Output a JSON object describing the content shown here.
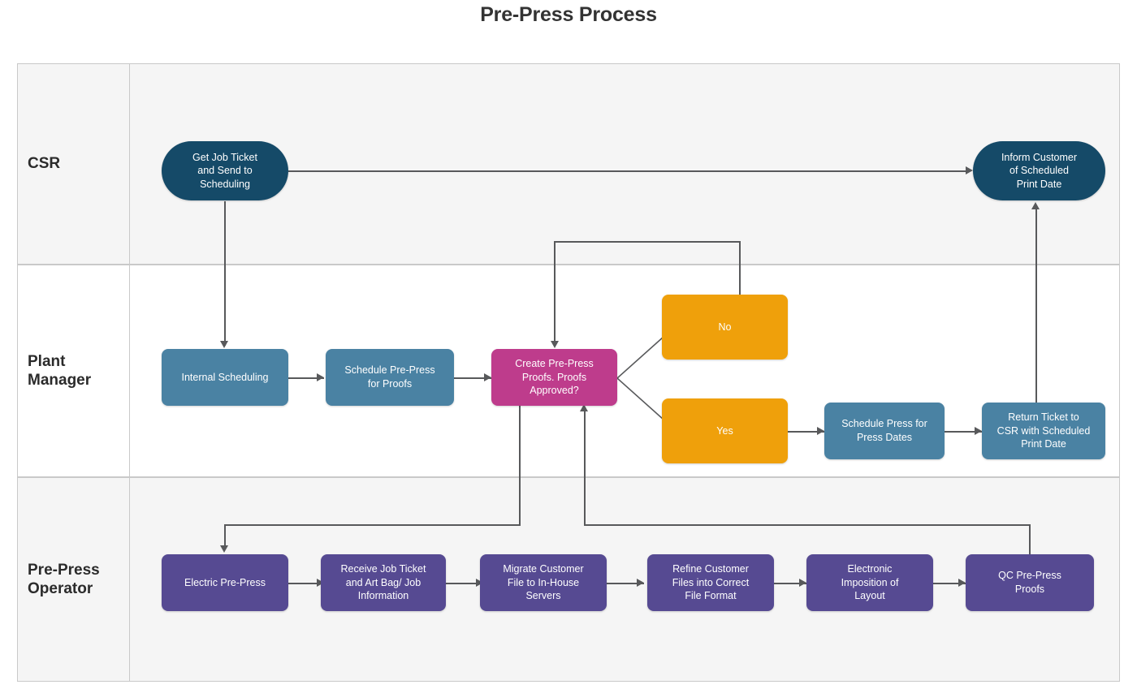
{
  "title": "Pre-Press Process",
  "colors": {
    "navy": "#154A68",
    "steel_blue": "#4A82A3",
    "magenta": "#BE3C8C",
    "orange": "#EFA00B",
    "purple": "#564A92",
    "connector": "#58595b",
    "lane_border": "#c9c9c9",
    "lane_shaded": "#f5f5f5",
    "lane_plain": "#ffffff"
  },
  "lanes": [
    {
      "id": "csr",
      "label": "CSR"
    },
    {
      "id": "plant-manager",
      "label": "Plant\nManager"
    },
    {
      "id": "pre-press-operator",
      "label": "Pre-Press\nOperator"
    }
  ],
  "nodes": {
    "get_job_ticket": {
      "label": "Get Job Ticket\nand Send to\nScheduling",
      "lane": "csr",
      "shape": "pill",
      "color": "navy"
    },
    "inform_customer": {
      "label": "Inform Customer\nof Scheduled\nPrint Date",
      "lane": "csr",
      "shape": "pill",
      "color": "navy"
    },
    "internal_scheduling": {
      "label": "Internal Scheduling",
      "lane": "plant-manager",
      "shape": "rounded-rect",
      "color": "steel_blue"
    },
    "schedule_prepress": {
      "label": "Schedule Pre-Press\nfor Proofs",
      "lane": "plant-manager",
      "shape": "rounded-rect",
      "color": "steel_blue"
    },
    "create_prepress_proofs": {
      "label": "Create Pre-Press\nProofs. Proofs\nApproved?",
      "lane": "plant-manager",
      "shape": "rounded-rect",
      "color": "magenta"
    },
    "decision_no": {
      "label": "No",
      "lane": "plant-manager",
      "shape": "rounded-rect",
      "color": "orange"
    },
    "decision_yes": {
      "label": "Yes",
      "lane": "plant-manager",
      "shape": "rounded-rect",
      "color": "orange"
    },
    "schedule_press": {
      "label": "Schedule Press for\nPress Dates",
      "lane": "plant-manager",
      "shape": "rounded-rect",
      "color": "steel_blue"
    },
    "return_ticket": {
      "label": "Return Ticket to\nCSR with Scheduled\nPrint Date",
      "lane": "plant-manager",
      "shape": "rounded-rect",
      "color": "steel_blue"
    },
    "electric_prepress": {
      "label": "Electric Pre-Press",
      "lane": "pre-press-operator",
      "shape": "rounded-rect",
      "color": "purple"
    },
    "receive_job_ticket": {
      "label": "Receive Job Ticket\nand Art Bag/ Job\nInformation",
      "lane": "pre-press-operator",
      "shape": "rounded-rect",
      "color": "purple"
    },
    "migrate_customer_file": {
      "label": "Migrate Customer\nFile to In-House\nServers",
      "lane": "pre-press-operator",
      "shape": "rounded-rect",
      "color": "purple"
    },
    "refine_customer_files": {
      "label": "Refine Customer\nFiles into Correct\nFile Format",
      "lane": "pre-press-operator",
      "shape": "rounded-rect",
      "color": "purple"
    },
    "electronic_imposition": {
      "label": "Electronic\nImposition of\nLayout",
      "lane": "pre-press-operator",
      "shape": "rounded-rect",
      "color": "purple"
    },
    "qc_prepress_proofs": {
      "label": "QC Pre-Press\nProofs",
      "lane": "pre-press-operator",
      "shape": "rounded-rect",
      "color": "purple"
    }
  },
  "edges": [
    {
      "from": "get_job_ticket",
      "to": "inform_customer",
      "label": ""
    },
    {
      "from": "get_job_ticket",
      "to": "internal_scheduling",
      "label": ""
    },
    {
      "from": "internal_scheduling",
      "to": "schedule_prepress",
      "label": ""
    },
    {
      "from": "schedule_prepress",
      "to": "create_prepress_proofs",
      "label": ""
    },
    {
      "from": "create_prepress_proofs",
      "to": "decision_no",
      "label": ""
    },
    {
      "from": "create_prepress_proofs",
      "to": "decision_yes",
      "label": ""
    },
    {
      "from": "decision_no",
      "to": "create_prepress_proofs",
      "label": ""
    },
    {
      "from": "decision_yes",
      "to": "schedule_press",
      "label": ""
    },
    {
      "from": "schedule_press",
      "to": "return_ticket",
      "label": ""
    },
    {
      "from": "return_ticket",
      "to": "inform_customer",
      "label": ""
    },
    {
      "from": "create_prepress_proofs",
      "to": "electric_prepress",
      "label": ""
    },
    {
      "from": "electric_prepress",
      "to": "receive_job_ticket",
      "label": ""
    },
    {
      "from": "receive_job_ticket",
      "to": "migrate_customer_file",
      "label": ""
    },
    {
      "from": "migrate_customer_file",
      "to": "refine_customer_files",
      "label": ""
    },
    {
      "from": "refine_customer_files",
      "to": "electronic_imposition",
      "label": ""
    },
    {
      "from": "electronic_imposition",
      "to": "qc_prepress_proofs",
      "label": ""
    },
    {
      "from": "qc_prepress_proofs",
      "to": "create_prepress_proofs",
      "label": ""
    }
  ]
}
